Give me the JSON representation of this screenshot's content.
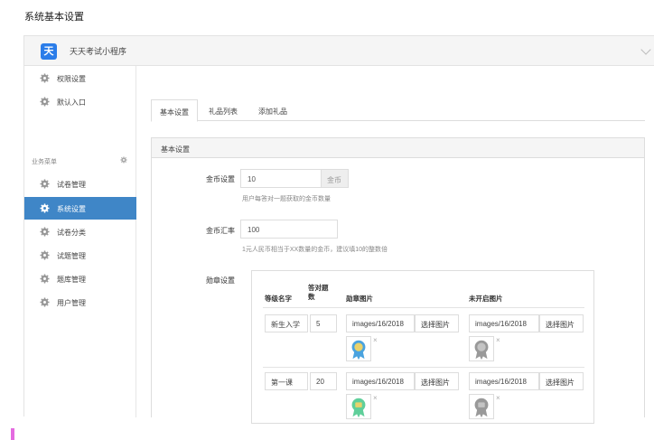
{
  "page": {
    "title": "系统基本设置"
  },
  "app": {
    "logo_char": "天",
    "name": "天天考试小程序"
  },
  "sidebar": {
    "top_items": [
      {
        "label": "权限设置",
        "icon": "gear-icon"
      },
      {
        "label": "默认入口",
        "icon": "gear-icon"
      }
    ],
    "section": {
      "label": "业务菜单"
    },
    "items": [
      {
        "label": "试卷管理",
        "icon": "gear-icon",
        "active": false
      },
      {
        "label": "系统设置",
        "icon": "gear-icon",
        "active": true
      },
      {
        "label": "试卷分类",
        "icon": "gear-icon",
        "active": false
      },
      {
        "label": "试题管理",
        "icon": "gear-icon",
        "active": false
      },
      {
        "label": "题库管理",
        "icon": "gear-icon",
        "active": false
      },
      {
        "label": "用户管理",
        "icon": "gear-icon",
        "active": false
      }
    ]
  },
  "tabs": [
    {
      "label": "基本设置",
      "active": true
    },
    {
      "label": "礼品列表",
      "active": false
    },
    {
      "label": "添加礼品",
      "active": false
    }
  ],
  "panel": {
    "title": "基本设置",
    "coin": {
      "label": "金币设置",
      "value": "10",
      "addon": "金币",
      "help": "用户每答对一题获取的金币数量"
    },
    "rate": {
      "label": "金币汇率",
      "value": "100",
      "help": "1元人民币相当于XX数量的金币，建议填10的整数倍"
    },
    "levels": {
      "label": "勋章设置",
      "headers": {
        "name": "等级名字",
        "count_line1": "答对题",
        "count_line2": "数",
        "badge": "勋章图片",
        "locked": "未开启图片"
      },
      "rows": [
        {
          "name": "新生入学",
          "count": "5",
          "badge_path": "images/16/2018",
          "badge_btn": "选择图片",
          "locked_path": "images/16/2018",
          "locked_btn": "选择图片",
          "badge_color": "#4aa3df",
          "remove": "×"
        },
        {
          "name": "第一课",
          "count": "20",
          "badge_path": "images/16/2018",
          "badge_btn": "选择图片",
          "locked_path": "images/16/2018",
          "locked_btn": "选择图片",
          "badge_color": "#5fcf9a",
          "remove": "×"
        }
      ]
    }
  },
  "colors": {
    "accent": "#3f86c7",
    "logo": "#2b7de9"
  }
}
